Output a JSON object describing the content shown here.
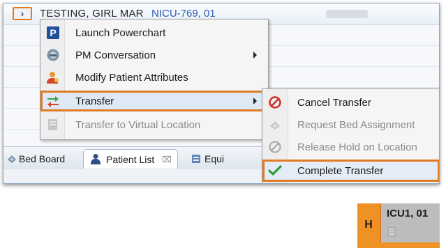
{
  "patient_row": {
    "name": "TESTING, GIRL MAR",
    "fin": "NICU-769, 01"
  },
  "context_menu": {
    "items": [
      {
        "label": "Launch Powerchart",
        "icon": "powerchart-icon",
        "disabled": false,
        "submenu": false
      },
      {
        "label": "PM Conversation",
        "icon": "pm-conversation-icon",
        "disabled": false,
        "submenu": true
      },
      {
        "label": "Modify Patient Attributes",
        "icon": "modify-patient-icon",
        "disabled": false,
        "submenu": false
      },
      {
        "label": "Transfer",
        "icon": "transfer-icon",
        "disabled": false,
        "submenu": true,
        "highlighted": true
      },
      {
        "label": "Transfer to Virtual Location",
        "icon": "virtual-location-icon",
        "disabled": true,
        "submenu": false
      }
    ]
  },
  "transfer_submenu": {
    "items": [
      {
        "label": "Cancel Transfer",
        "icon": "cancel-icon",
        "disabled": false
      },
      {
        "label": "Request Bed Assignment",
        "icon": "request-bed-icon",
        "disabled": true
      },
      {
        "label": "Release Hold on Location",
        "icon": "release-hold-icon",
        "disabled": true
      },
      {
        "label": "Complete Transfer",
        "icon": "checkmark-icon",
        "disabled": false,
        "highlighted": true
      }
    ]
  },
  "tabs": [
    {
      "label": "Bed Board",
      "icon": "bed-board-icon"
    },
    {
      "label": "Patient List",
      "icon": "patient-list-icon",
      "active": true,
      "close": "⌧"
    },
    {
      "label": "Equi",
      "icon": "equipment-icon"
    }
  ],
  "bed_tile": {
    "status_letter": "H",
    "location": "ICU1, 01",
    "accent_color": "#f09126"
  },
  "colors": {
    "highlight_outline": "#e07b22",
    "menu_background": "#f5f5f5"
  }
}
